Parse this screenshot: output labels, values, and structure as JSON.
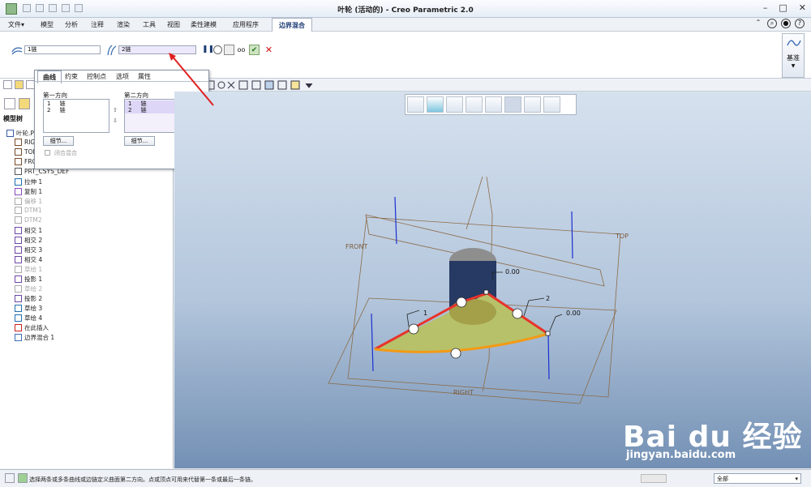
{
  "window": {
    "title": "叶轮 (活动的) - Creo Parametric 2.0"
  },
  "menubar": {
    "file": "文件▾",
    "tabs": [
      "模型",
      "分析",
      "注释",
      "渲染",
      "工具",
      "视图",
      "柔性建模",
      "应用程序"
    ],
    "active_tab": "边界混合"
  },
  "ribbon": {
    "first_field": "1链",
    "second_field": "2链",
    "datum_label": "基准"
  },
  "flyout": {
    "tabs": [
      "曲线",
      "约束",
      "控制点",
      "选项",
      "属性"
    ],
    "first_dir_label": "第一方向",
    "second_dir_label": "第二方向",
    "first_rows": [
      {
        "idx": "1",
        "val": "链"
      },
      {
        "idx": "2",
        "val": "链"
      }
    ],
    "second_rows": [
      {
        "idx": "1",
        "val": "链"
      },
      {
        "idx": "2",
        "val": "链"
      }
    ],
    "details_btn": "细节...",
    "closed_blend": "闭合混合"
  },
  "tree": {
    "header": "模型树",
    "items": [
      {
        "label": "叶轮.PRT",
        "gray": false
      },
      {
        "label": "RIG",
        "gray": false
      },
      {
        "label": "TOP",
        "gray": false
      },
      {
        "label": "FRO",
        "gray": false
      },
      {
        "label": "PRT_CSYS_DEF",
        "gray": false
      },
      {
        "label": "拉伸 1",
        "gray": false
      },
      {
        "label": "复制 1",
        "gray": false
      },
      {
        "label": "偏移 1",
        "gray": true
      },
      {
        "label": "DTM1",
        "gray": true
      },
      {
        "label": "DTM2",
        "gray": true
      },
      {
        "label": "相交 1",
        "gray": false
      },
      {
        "label": "相交 2",
        "gray": false
      },
      {
        "label": "相交 3",
        "gray": false
      },
      {
        "label": "相交 4",
        "gray": false
      },
      {
        "label": "草绘 1",
        "gray": true
      },
      {
        "label": "投影 1",
        "gray": false
      },
      {
        "label": "草绘 2",
        "gray": true
      },
      {
        "label": "投影 2",
        "gray": false
      },
      {
        "label": "草绘 3",
        "gray": false
      },
      {
        "label": "草绘 4",
        "gray": false
      },
      {
        "label": "在此插入",
        "gray": false
      },
      {
        "label": "边界混合 1",
        "gray": false
      }
    ]
  },
  "viewport": {
    "labels": {
      "front": "FRONT",
      "top": "TOP",
      "right": "RIGHT",
      "dim1": "0.00",
      "dim2": "0.00",
      "n1": "1",
      "n2": "2"
    }
  },
  "status": {
    "message": "选择两条或多条曲线或边链定义曲面第二方向。点或顶点可用来代替第一条或最后一条链。",
    "filter": "全部"
  },
  "watermark": {
    "brand": "Bai du 经验",
    "url": "jingyan.baidu.com"
  },
  "colors": {
    "accent": "#1a3a73",
    "surface": "#b8c36a",
    "boundary": "#e8332a",
    "edge": "#f29a16"
  }
}
